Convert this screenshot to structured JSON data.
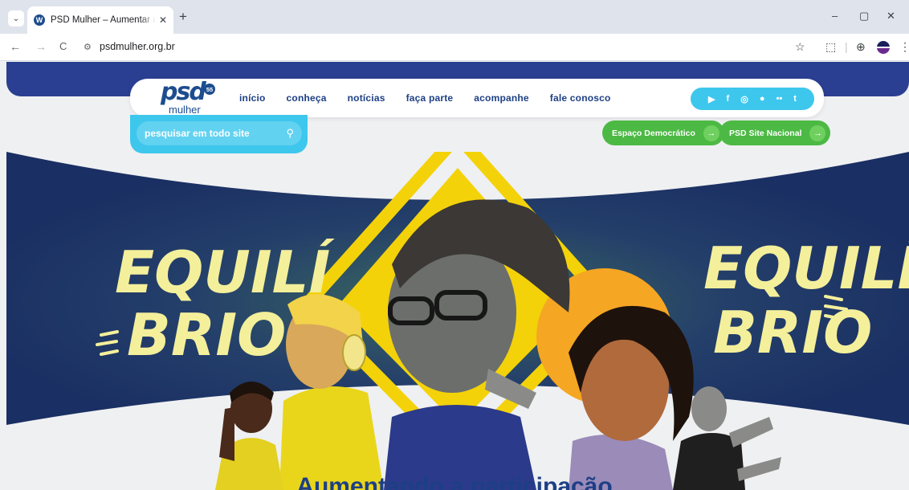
{
  "browser": {
    "tab": {
      "title": "PSD Mulher – Aumentar a participação",
      "favicon": "wordpress-icon",
      "close": "✕"
    },
    "new_tab": "+",
    "address": {
      "url": "psdmulher.org.br",
      "site_info_icon": "tune-icon"
    },
    "controls": {
      "back": "←",
      "forward": "→",
      "reload": "C",
      "bookmark": "☆",
      "extensions": "⬚",
      "window_minimize": "–",
      "window_restore": "▢",
      "window_close": "✕"
    }
  },
  "site": {
    "logo": {
      "main": "psd",
      "badge": "55",
      "sub": "mulher"
    },
    "menu": [
      "início",
      "conheça",
      "notícias",
      "faça parte",
      "acompanhe",
      "fale conosco"
    ],
    "social": [
      "youtube-icon",
      "facebook-icon",
      "instagram-icon",
      "spotify-icon",
      "flickr-icon",
      "tumblr-icon"
    ],
    "search": {
      "placeholder": "pesquisar em todo site"
    },
    "buttons": {
      "espaco": "Espaço Democrático",
      "nacional": "PSD Site Nacional"
    },
    "hero": {
      "word_left_top": "EQUILÍ",
      "word_left_bottom": "BRIO",
      "word_right_top": "EQUILÍ",
      "word_right_bottom": "BRIO"
    },
    "heading": "Aumentando a participação"
  },
  "colors": {
    "navy": "#2a3f91",
    "cyan": "#3ec7ec",
    "green": "#4cb944",
    "yellow": "#f4ef9b",
    "heading": "#1d3f85"
  }
}
